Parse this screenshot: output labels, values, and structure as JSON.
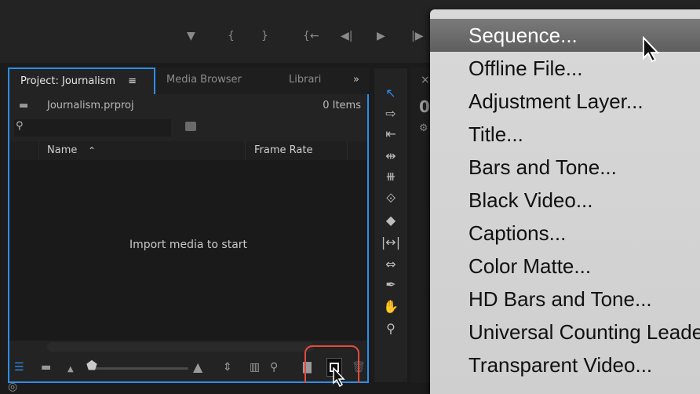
{
  "project_panel": {
    "tabs": {
      "project": "Project: Journalism",
      "project_menu": "≡",
      "media_browser": "Media Browser",
      "libraries": "Librari",
      "overflow": "»"
    },
    "file_name": "Journalism.prproj",
    "item_count": "0 Items",
    "columns": {
      "name": "Name",
      "name_sort": "⌃",
      "frame_rate": "Frame Rate"
    },
    "empty_message": "Import media to start"
  },
  "program_panel": {
    "close": "×",
    "digit": "0"
  },
  "new_item_menu": {
    "items": [
      "Sequence...",
      "Offline File...",
      "Adjustment Layer...",
      "Title...",
      "Bars and Tone...",
      "Black Video...",
      "Captions...",
      "Color Matte...",
      "HD Bars and Tone...",
      "Universal Counting Leader...",
      "Transparent Video..."
    ],
    "hovered_index": 0
  },
  "colors": {
    "panel_focus": "#2d8ceb",
    "highlight_ring": "#e54b3c",
    "menu_hover": "#6a6a6a"
  }
}
